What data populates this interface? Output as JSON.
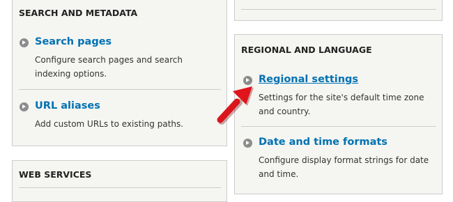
{
  "left_top_panel": {
    "title": "SEARCH AND METADATA",
    "items": [
      {
        "label": "Search pages",
        "description": "Configure search pages and search indexing options."
      },
      {
        "label": "URL aliases",
        "description": "Add custom URLs to existing paths."
      }
    ]
  },
  "left_bottom_panel": {
    "title": "WEB SERVICES"
  },
  "right_panel": {
    "title": "REGIONAL AND LANGUAGE",
    "items": [
      {
        "label": "Regional settings",
        "description": "Settings for the site's default time zone and country."
      },
      {
        "label": "Date and time formats",
        "description": "Configure display format strings for date and time."
      }
    ]
  },
  "colors": {
    "link": "#0071b3",
    "panel_bg": "#f5f5f2",
    "annotation_arrow": "#e0141b"
  },
  "icons": {
    "bullet": "chevron-right-circle-icon",
    "annotation": "red-arrow-pointer"
  }
}
